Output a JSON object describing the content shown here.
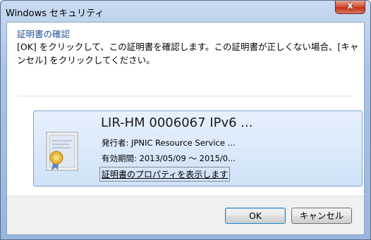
{
  "window": {
    "title": "Windows セキュリティ",
    "close_label": "x"
  },
  "dialog": {
    "heading": "証明書の確認",
    "description": "[OK] をクリックして、この証明書を確認します。この証明書が正しくない場合、[キャンセル] をクリックしてください。"
  },
  "certificate": {
    "icon": "certificate-icon",
    "title": "LIR-HM 0006067 IPv6 ...",
    "issuer": "発行者: JPNIC Resource Service ...",
    "validity": "有効期間: 2013/05/09 ～ 2015/0...",
    "properties_link": "証明書のプロパティを表示します"
  },
  "buttons": {
    "ok": "OK",
    "cancel": "キャンセル"
  },
  "colors": {
    "heading": "#1f4e9c",
    "card_background": "#d8e8fa",
    "card_border": "#7da2ce",
    "close_button": "#c4341a"
  }
}
